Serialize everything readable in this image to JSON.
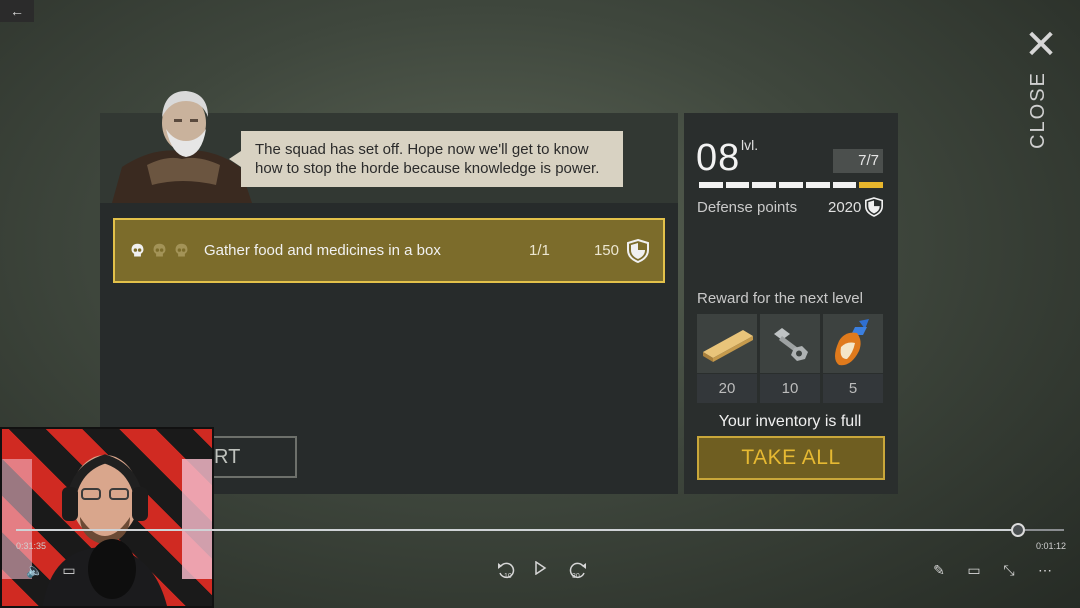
{
  "window": {
    "back_icon": "arrow-left-icon"
  },
  "close": {
    "icon": "close-icon",
    "label": "CLOSE"
  },
  "dialog": {
    "speech": "The squad has set off. Hope now we'll get to know how to stop the horde because knowledge is power."
  },
  "task": {
    "text": "Gather food and medicines in a box",
    "progress": "1/1",
    "points": "150",
    "skulls_total": 3,
    "skulls_active": 1
  },
  "start_button": {
    "label_visible": "RT"
  },
  "level": {
    "number": "08",
    "unit": "lvl.",
    "progress_text": "7/7",
    "segments_total": 7,
    "defense_label": "Defense points",
    "defense_value": "2020"
  },
  "reward": {
    "label": "Reward for the next level",
    "items": [
      {
        "icon": "wood-plank-icon",
        "qty": "20"
      },
      {
        "icon": "bolt-nut-icon",
        "qty": "10"
      },
      {
        "icon": "glue-tube-icon",
        "qty": "5"
      }
    ],
    "inventory_full": "Your inventory is full",
    "take_all": "TAKE ALL"
  },
  "player": {
    "time_elapsed": "0:31:35",
    "time_remaining": "0:01:12",
    "progress_fraction": 0.956,
    "rewind_seconds": "10",
    "forward_seconds": "30"
  },
  "colors": {
    "accent_gold": "#e3c14a",
    "task_bg": "#7c6c2b",
    "take_all_text": "#e6b932"
  }
}
